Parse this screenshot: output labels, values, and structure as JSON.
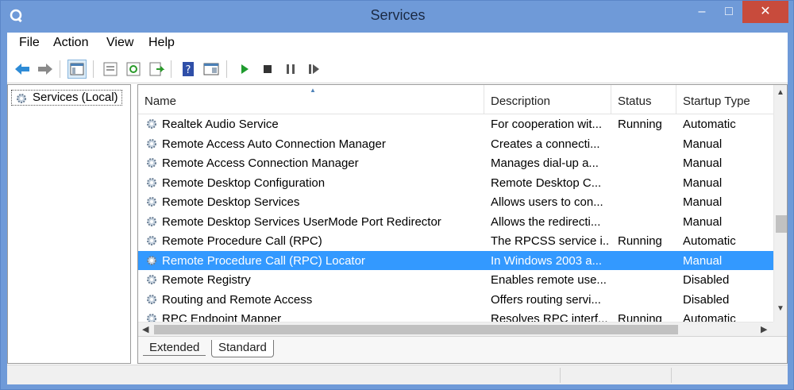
{
  "window": {
    "title": "Services",
    "controls": {
      "minimize": "–",
      "maximize": "□",
      "close": "✕"
    }
  },
  "menu": [
    "File",
    "Action",
    "View",
    "Help"
  ],
  "toolbar": [
    "back-arrow-icon",
    "forward-arrow-icon",
    "show-hide-console-tree-icon",
    "properties-icon",
    "refresh-icon",
    "export-list-icon",
    "help-icon",
    "show-hide-action-pane-icon",
    "play-icon",
    "stop-icon",
    "pause-icon",
    "resume-icon"
  ],
  "tree": {
    "root_label": "Services (Local)"
  },
  "table": {
    "columns": [
      "Name",
      "Description",
      "Status",
      "Startup Type"
    ],
    "rows": [
      {
        "name": "Realtek Audio Service",
        "description": "For cooperation wit...",
        "status": "Running",
        "startup": "Automatic",
        "selected": false
      },
      {
        "name": "Remote Access Auto Connection Manager",
        "description": "Creates a connecti...",
        "status": "",
        "startup": "Manual",
        "selected": false
      },
      {
        "name": "Remote Access Connection Manager",
        "description": "Manages dial-up a...",
        "status": "",
        "startup": "Manual",
        "selected": false
      },
      {
        "name": "Remote Desktop Configuration",
        "description": "Remote Desktop C...",
        "status": "",
        "startup": "Manual",
        "selected": false
      },
      {
        "name": "Remote Desktop Services",
        "description": "Allows users to con...",
        "status": "",
        "startup": "Manual",
        "selected": false
      },
      {
        "name": "Remote Desktop Services UserMode Port Redirector",
        "description": "Allows the redirecti...",
        "status": "",
        "startup": "Manual",
        "selected": false
      },
      {
        "name": "Remote Procedure Call (RPC)",
        "description": "The RPCSS service i...",
        "status": "Running",
        "startup": "Automatic",
        "selected": false
      },
      {
        "name": "Remote Procedure Call (RPC) Locator",
        "description": "In Windows 2003 a...",
        "status": "",
        "startup": "Manual",
        "selected": true
      },
      {
        "name": "Remote Registry",
        "description": "Enables remote use...",
        "status": "",
        "startup": "Disabled",
        "selected": false
      },
      {
        "name": "Routing and Remote Access",
        "description": "Offers routing servi...",
        "status": "",
        "startup": "Disabled",
        "selected": false
      },
      {
        "name": "RPC Endpoint Mapper",
        "description": "Resolves RPC interf...",
        "status": "Running",
        "startup": "Automatic",
        "selected": false
      }
    ]
  },
  "tabs": {
    "extended": "Extended",
    "standard": "Standard",
    "active": "Standard"
  },
  "colors": {
    "titlebar": "#6f9ad8",
    "selection": "#3399ff",
    "close": "#c84b3c"
  }
}
